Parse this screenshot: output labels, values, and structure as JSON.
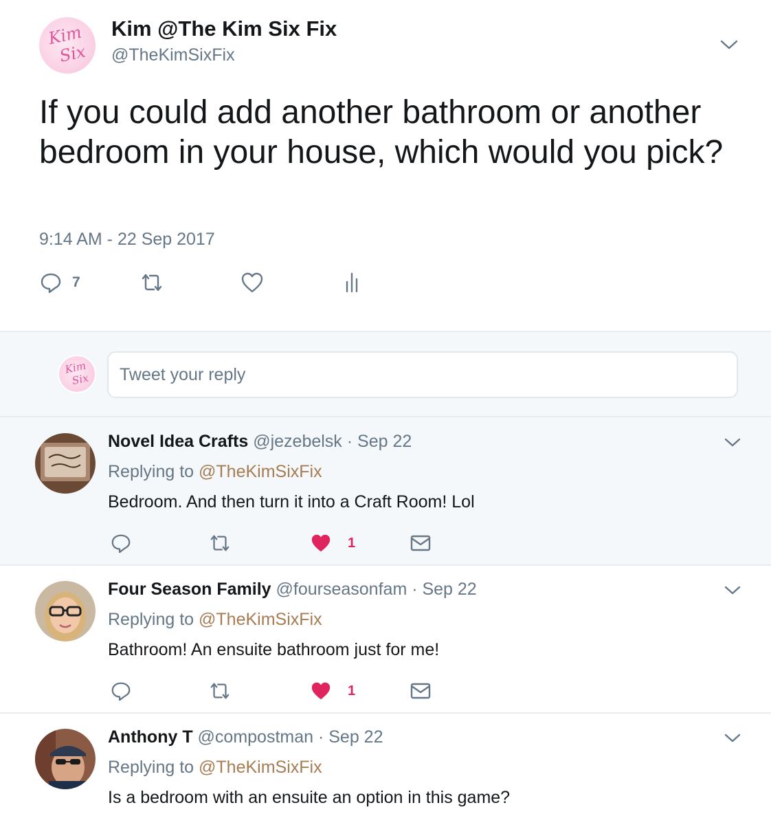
{
  "main_tweet": {
    "author_name": "Kim @The Kim Six Fix",
    "author_handle": "@TheKimSixFix",
    "avatar_logo_text": "Kim Six",
    "text": "If you could add another bathroom or another bedroom in your house, which would you pick?",
    "timestamp": "9:14 AM - 22 Sep 2017",
    "reply_count": "7",
    "icons": {
      "reply": "reply-icon",
      "retweet": "retweet-icon",
      "like": "heart-icon",
      "analytics": "analytics-icon",
      "menu": "chevron-down-icon"
    }
  },
  "composer": {
    "placeholder": "Tweet your reply"
  },
  "replies": [
    {
      "name": "Novel Idea Crafts",
      "handle_date": "@jezebelsk · Sep 22",
      "replying_label": "Replying to ",
      "replying_to": "@TheKimSixFix",
      "text": "Bedroom. And then turn it into a Craft Room! Lol",
      "like_count": "1",
      "liked": true,
      "highlighted": true
    },
    {
      "name": "Four Season Family",
      "handle_date": "@fourseasonfam · Sep 22",
      "replying_label": "Replying to ",
      "replying_to": "@TheKimSixFix",
      "text": "Bathroom! An ensuite bathroom just for me!",
      "like_count": "1",
      "liked": true,
      "highlighted": false
    },
    {
      "name": "Anthony T",
      "handle_date": "@compostman · Sep 22",
      "replying_label": "Replying to ",
      "replying_to": "@TheKimSixFix",
      "text": "Is a bedroom with an ensuite an option in this game?",
      "highlighted": false
    }
  ],
  "colors": {
    "text_primary": "#14171a",
    "text_secondary": "#657786",
    "mention": "#a67c52",
    "like_red": "#e0245e",
    "panel_bg": "#f5f8fa",
    "divider": "#e6ecf0"
  }
}
